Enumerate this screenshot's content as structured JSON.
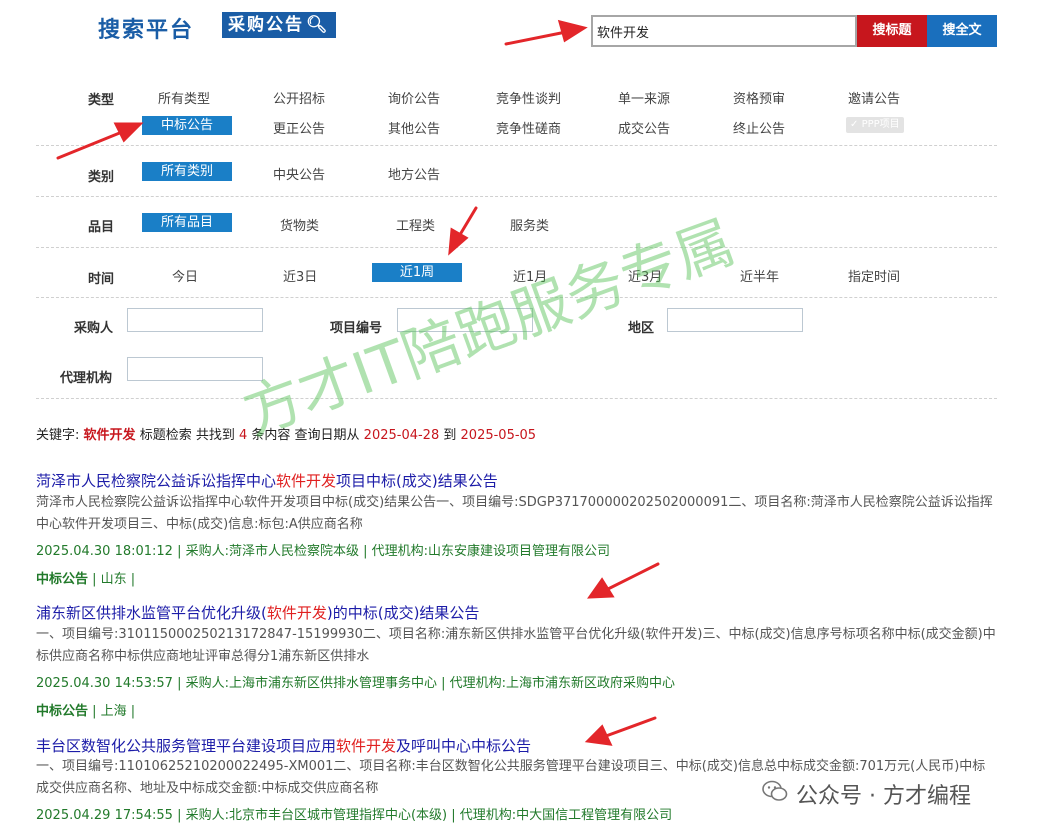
{
  "header": {
    "logo_main": "搜索平台",
    "logo_sub": "采购公告",
    "search_value": "软件开发",
    "btn_title": "搜标题",
    "btn_full": "搜全文"
  },
  "filters": {
    "type_label": "类型",
    "type_row1": [
      "所有类型",
      "公开招标",
      "询价公告",
      "竞争性谈判",
      "单一来源",
      "资格预审",
      "邀请公告"
    ],
    "type_row2": [
      "中标公告",
      "更正公告",
      "其他公告",
      "竞争性磋商",
      "成交公告",
      "终止公告"
    ],
    "ppp": "PPP项目",
    "category_label": "类别",
    "category": [
      "所有类别",
      "中央公告",
      "地方公告"
    ],
    "item_label": "品目",
    "item": [
      "所有品目",
      "货物类",
      "工程类",
      "服务类"
    ],
    "time_label": "时间",
    "time": [
      "今日",
      "近3日",
      "近1周",
      "近1月",
      "近3月",
      "近半年",
      "指定时间"
    ],
    "buyer_label": "采购人",
    "project_no_label": "项目编号",
    "region_label": "地区",
    "agency_label": "代理机构"
  },
  "summary": {
    "prefix": "关键字:",
    "keyword": "软件开发",
    "mid1": "标题检索 共找到",
    "count": "4",
    "mid2": "条内容 查询日期从",
    "date_from": "2025-04-28",
    "to": "到",
    "date_to": "2025-05-05"
  },
  "results": [
    {
      "title_pre": "菏泽市人民检察院公益诉讼指挥中心",
      "title_hl": "软件开发",
      "title_post": "项目中标(成交)结果公告",
      "desc": "菏泽市人民检察院公益诉讼指挥中心软件开发项目中标(成交)结果公告一、项目编号:SDGP371700000202502000091二、项目名称:菏泽市人民检察院公益诉讼指挥中心软件开发项目三、中标(成交)信息:标包:A供应商名称",
      "meta": "2025.04.30 18:01:12 | 采购人:菏泽市人民检察院本级 | 代理机构:山东安康建设项目管理有限公司",
      "tag": "中标公告",
      "region": "| 山东 |"
    },
    {
      "title_pre": "浦东新区供排水监管平台优化升级(",
      "title_hl": "软件开发",
      "title_post": ")的中标(成交)结果公告",
      "desc": "一、项目编号:310115000250213172847-15199930二、项目名称:浦东新区供排水监管平台优化升级(软件开发)三、中标(成交)信息序号标项名称中标(成交金额)中标供应商名称中标供应商地址评审总得分1浦东新区供排水",
      "meta": "2025.04.30 14:53:57 | 采购人:上海市浦东新区供排水管理事务中心 | 代理机构:上海市浦东新区政府采购中心",
      "tag": "中标公告",
      "region": "| 上海 |"
    },
    {
      "title_pre": "丰台区数智化公共服务管理平台建设项目应用",
      "title_hl": "软件开发",
      "title_post": "及呼叫中心中标公告",
      "desc": "一、项目编号:11010625210200022495-XM001二、项目名称:丰台区数智化公共服务管理平台建设项目三、中标(成交)信息总中标成交金额:701万元(人民币)中标成交供应商名称、地址及中标成交金额:中标成交供应商名称",
      "meta": "2025.04.29 17:54:55 | 采购人:北京市丰台区城市管理指挥中心(本级) | 代理机构:中大国信工程管理有限公司"
    }
  ],
  "watermark": "方才IT陪跑服务专属",
  "wechat": "公众号 · 方才编程",
  "colors": {
    "brand_blue": "#1a5da6",
    "select_blue": "#1a7fc7",
    "red": "#c7161d",
    "title_blue": "#1c1ca8",
    "meta_green": "#227a2b",
    "arrow_red": "#e3262a"
  }
}
